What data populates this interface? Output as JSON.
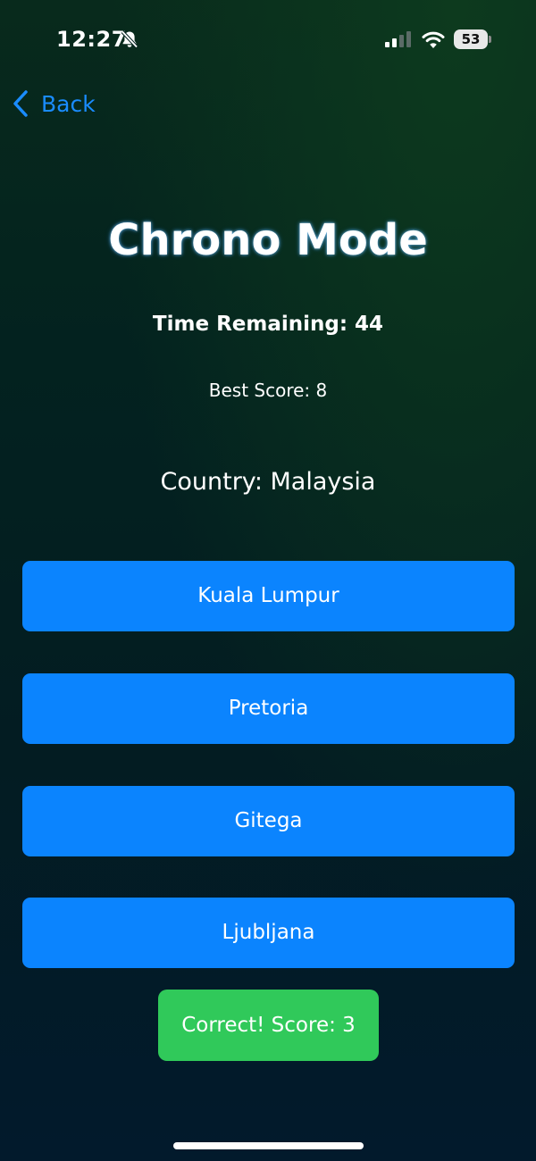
{
  "status_bar": {
    "time": "12:27",
    "battery_level": "53",
    "icons": [
      "bell-slash-icon",
      "cellular-signal-icon",
      "wifi-icon",
      "battery-icon"
    ]
  },
  "nav": {
    "back_label": "Back",
    "back_icon": "chevron-left-icon"
  },
  "game": {
    "title": "Chrono Mode",
    "time_remaining": "Time Remaining: 44",
    "best_score": "Best Score: 8",
    "country": "Country: Malaysia",
    "options": [
      "Kuala Lumpur",
      "Pretoria",
      "Gitega",
      "Ljubljana"
    ],
    "feedback": "Correct! Score: 3"
  },
  "colors": {
    "accent": "#0b84fe",
    "back_link": "#1a8cff",
    "success": "#30c95a",
    "background_top": "#082a1c",
    "background_bottom": "#021a2c"
  }
}
